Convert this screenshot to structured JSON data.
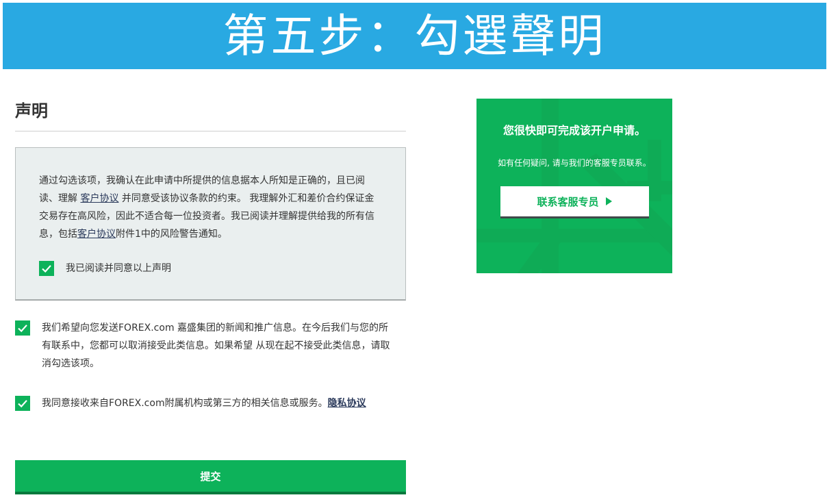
{
  "banner": {
    "title": "第五步：勾選聲明"
  },
  "declaration": {
    "heading": "声明",
    "text_part1": "通过勾选该项，我确认在此申请中所提供的信息据本人所知是正确的，且已阅读、理解 ",
    "link1": "客户协议",
    "text_part2": " 并同意受该协议条款的约束。 我理解外汇和差价合约保证金交易存在高风险，因此不适合每一位投资者。我已阅读并理解提供给我的所有信息，包括",
    "link2": "客户协议",
    "text_part3": "附件1中的风险警告通知。",
    "agree_label": "我已阅读并同意以上声明"
  },
  "options": {
    "marketing_label": "我们希望向您发送FOREX.com 嘉盛集团的新闻和推广信息。在今后我们与您的所有联系中，您都可以取消接受此类信息。如果希望 从现在起不接受此类信息，请取消勾选该项。",
    "third_party_label": "我同意接收来自FOREX.com附属机构或第三方的相关信息或服务。",
    "privacy_link": "隐私协议"
  },
  "submit": {
    "label": "提交"
  },
  "side_panel": {
    "headline": "您很快即可完成该开户申请。",
    "subtext": "如有任何疑问, 请与我们的客服专员联系。",
    "contact_button": "联系客服专员"
  },
  "colors": {
    "banner_blue": "#29a9e2",
    "brand_green": "#0db25a",
    "box_bg": "#eaefef"
  }
}
